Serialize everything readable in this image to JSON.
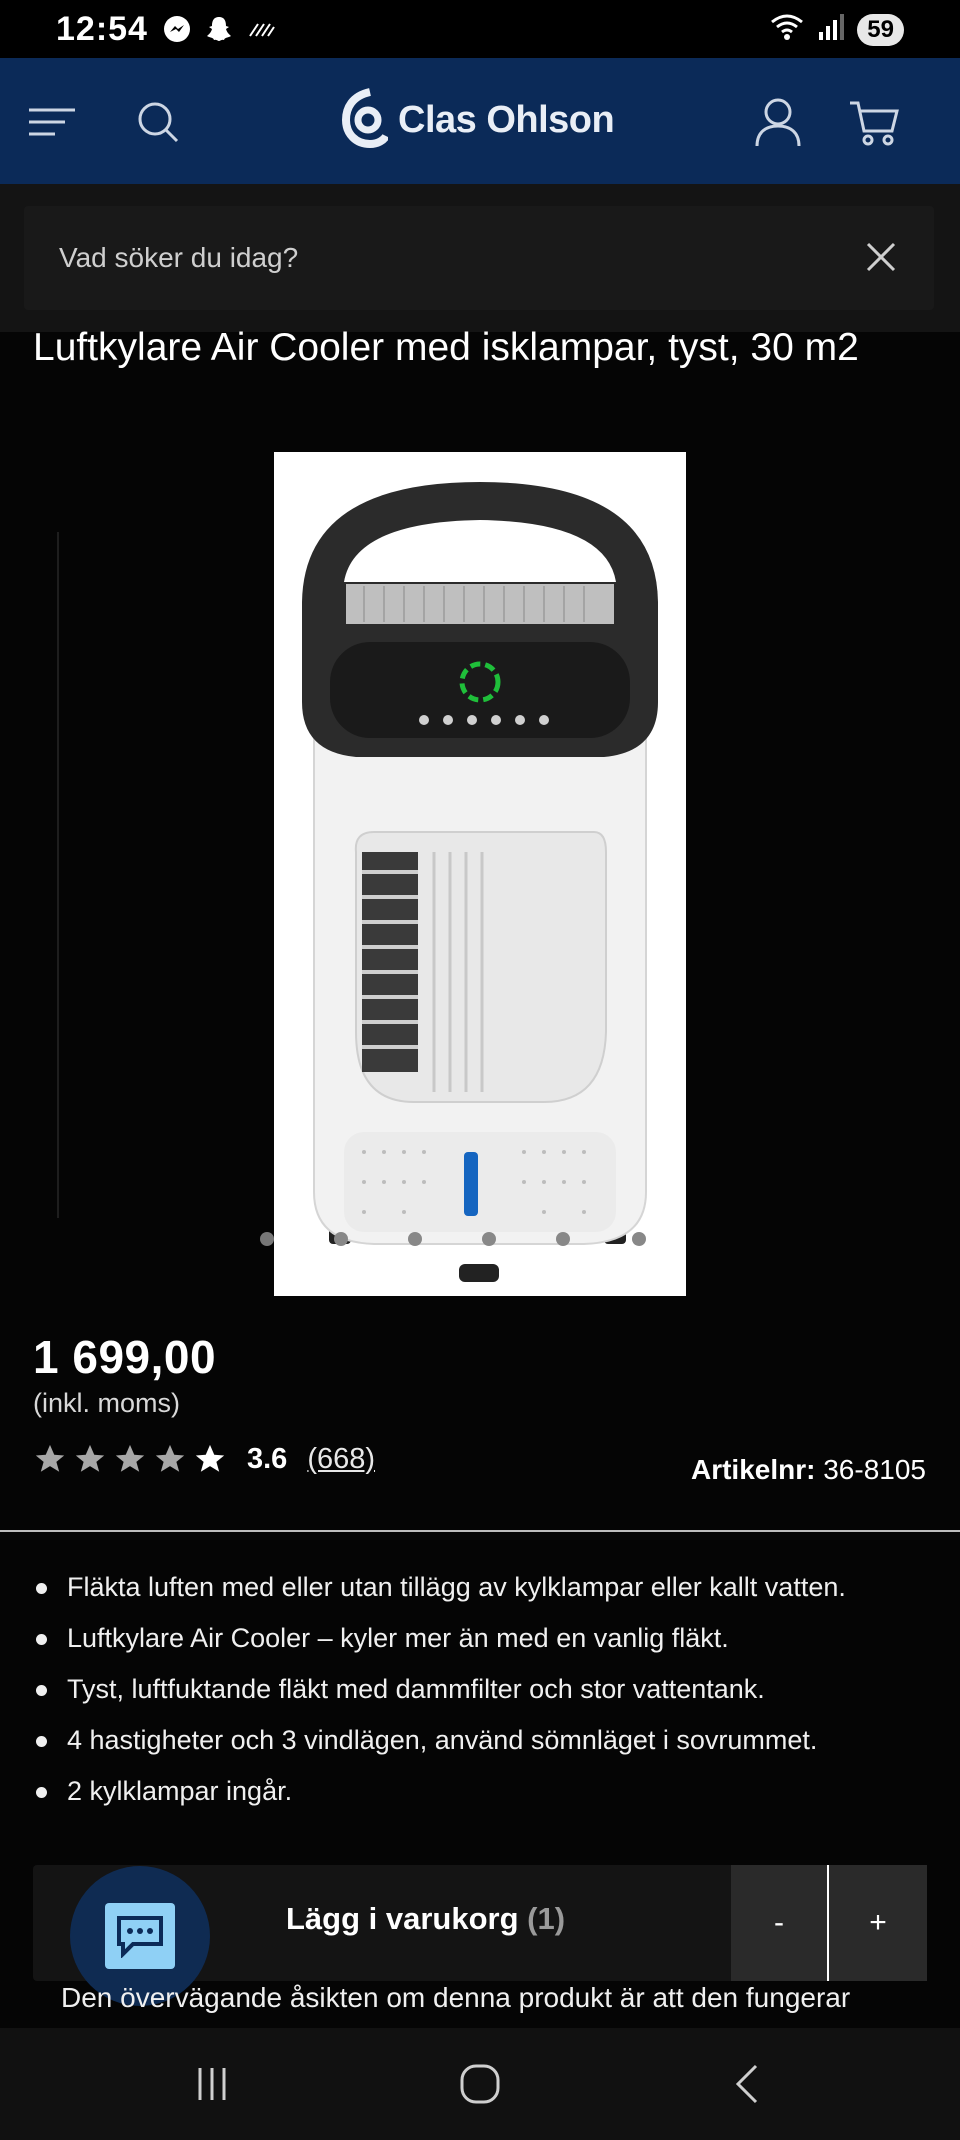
{
  "status": {
    "time": "12:54",
    "battery": "59",
    "app_icons": [
      "messenger-icon",
      "snapchat-icon",
      "signal-pattern-icon"
    ],
    "right_icons": [
      "wifi-icon",
      "signal-icon"
    ]
  },
  "header": {
    "brand": "Clas Ohlson",
    "icons": [
      "menu-icon",
      "search-icon",
      "logo-icon",
      "account-icon",
      "cart-icon"
    ],
    "brand_color": "#0b2a58"
  },
  "search": {
    "placeholder": "Vad söker du idag?",
    "close_icon": "close-icon"
  },
  "product": {
    "title": "Luftkylare Air Cooler med isklampar, tyst, 30 m2",
    "price": "1 699,00",
    "price_note": "(inkl. moms)",
    "rating": "3.6",
    "review_count": "(668)",
    "stars": 5,
    "article_label": "Artikelnr:",
    "article_number": "36-8105",
    "image_count": 6,
    "active_image": 0
  },
  "features": [
    "Fläkta luften med eller utan tillägg av kylklampar eller kallt vatten.",
    "Luftkylare Air Cooler – kyler mer än med en vanlig fläkt.",
    "Tyst, luftfuktande fläkt med dammfilter och stor vattentank.",
    "4 hastigheter och 3 vindlägen, använd sömnläget i sovrummet.",
    "2 kylklampar ingår."
  ],
  "cart": {
    "label": "Lägg i varukorg",
    "count": "(1)",
    "minus": "-",
    "plus": "+"
  },
  "summary": "Den övervägande åsikten om denna produkt är att den fungerar",
  "nav": [
    "recent-apps-icon",
    "home-icon",
    "back-icon"
  ]
}
